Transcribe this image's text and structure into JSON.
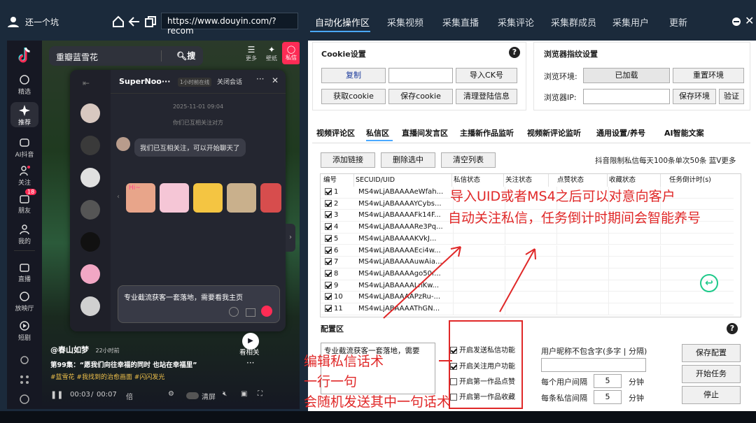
{
  "topbar": {
    "username": "还一个坑",
    "url": "https://www.douyin.com/?recom",
    "tabs": [
      "自动化操作区",
      "采集视频",
      "采集直播",
      "采集评论",
      "采集群成员",
      "采集用户",
      "更新"
    ]
  },
  "douyin": {
    "search_text": "重瓣蓝雪花",
    "search_button": "搜索",
    "top_icons": [
      "更多",
      "壁纸",
      "私信"
    ],
    "sidebar": [
      {
        "label": "精选",
        "icon": "globe-icon"
      },
      {
        "label": "推荐",
        "icon": "sparkle-icon"
      },
      {
        "label": "AI抖音",
        "icon": "ai-icon"
      },
      {
        "label": "关注",
        "icon": "follow-icon"
      },
      {
        "label": "朋友",
        "icon": "friends-icon",
        "badge": "18"
      },
      {
        "label": "我的",
        "icon": "user-icon"
      },
      {
        "label": "直播",
        "icon": "tv-icon"
      },
      {
        "label": "放映厅",
        "icon": "cinema-icon"
      },
      {
        "label": "短剧",
        "icon": "play-icon"
      }
    ],
    "chat": {
      "name": "SuperNoo···",
      "status": "1小时前在线",
      "close_label": "关闭会话",
      "date": "2025-11-01 09:04",
      "system_note": "你们已互相关注对方",
      "message": "我们已互相关注，可以开始聊天了",
      "sticker_text": "Hi~",
      "input_text": "专业截流获客一套落地，需要看我主页"
    },
    "video": {
      "author": "@春山如梦",
      "time_ago": "22小时前",
      "episode": "第99集：“愿我们向往幸福的同时 也站在幸福里”",
      "hashtags": "#蓝雪花 #我找到的治愈画面 #闪闪发光",
      "time_current": "00:03",
      "time_total": "00:07",
      "speed": "倍",
      "clear_label": "清屏",
      "side_label": "看相关"
    }
  },
  "cookie": {
    "title": "Cookie设置",
    "copy": "复制",
    "import": "导入CK号",
    "get": "获取cookie",
    "save": "保存cookie",
    "clear": "清理登陆信息"
  },
  "fingerprint": {
    "title": "浏览器指纹设置",
    "env_label": "浏览环境:",
    "env_value": "已加载",
    "reset": "重置环境",
    "ip_label": "浏览器IP:",
    "save_env": "保存环境",
    "verify": "验证"
  },
  "tabs2": [
    "视频评论区",
    "私信区",
    "直播间发言区",
    "主播新作品监听",
    "视频新评论监听",
    "通用设置/养号",
    "AI智能文案"
  ],
  "dm": {
    "add": "添加链接",
    "delete": "删除选中",
    "clear": "清空列表",
    "limit_note": "抖音限制私信每天100条单次50条 蓝V更多",
    "columns": [
      "编号",
      "SECUID/UID",
      "私信状态",
      "关注状态",
      "点赞状态",
      "收藏状态",
      "任务倒计时(s)"
    ],
    "rows": [
      {
        "num": "1",
        "uid": "MS4wLjABAAAAeWfah..."
      },
      {
        "num": "2",
        "uid": "MS4wLjABAAAAYCybs..."
      },
      {
        "num": "3",
        "uid": "MS4wLjABAAAAFk14F..."
      },
      {
        "num": "4",
        "uid": "MS4wLjABAAAARe3Pq..."
      },
      {
        "num": "5",
        "uid": "MS4wLjABAAAAKVkJ..."
      },
      {
        "num": "6",
        "uid": "MS4wLjABAAAAEci4w..."
      },
      {
        "num": "7",
        "uid": "MS4wLjABAAAAuwAia..."
      },
      {
        "num": "8",
        "uid": "MS4wLjABAAAAgo50r..."
      },
      {
        "num": "9",
        "uid": "MS4wLjABAAAALnKw..."
      },
      {
        "num": "10",
        "uid": "MS4wLjABAAAAPzRu-..."
      },
      {
        "num": "11",
        "uid": "MS4wLjABAAAAThGN..."
      }
    ]
  },
  "config": {
    "title": "配置区",
    "message_text": "专业截流获客一套落地，需要",
    "options": [
      {
        "label": "开启发送私信功能",
        "checked": true
      },
      {
        "label": "开启关注用户功能",
        "checked": true
      },
      {
        "label": "开启第一作品点赞",
        "checked": false
      },
      {
        "label": "开启第一作品收藏",
        "checked": false
      }
    ],
    "nickname_label": "用户昵称不包含字(多字 | 分隔)",
    "interval_user_label": "每个用户间隔",
    "interval_user_value": "5",
    "interval_dm_label": "每条私信间隔",
    "interval_dm_value": "5",
    "unit": "分钟",
    "save_config": "保存配置",
    "start": "开始任务",
    "stop": "停止"
  },
  "annotations": {
    "line1": "导入UID或者MS4之后可以对意向客户",
    "line2": "自动关注私信，任务倒计时期间会智能养号",
    "line3": "编辑私信话术",
    "line4": "一行一句",
    "line5": "会随机发送其中一句话术"
  },
  "colors": {
    "annotation_red": "#e02828",
    "topbar_bg": "#1b2a3b",
    "douyin_bg": "#161823",
    "accent_pink": "#fe2c55",
    "refresh_green": "#1ec98a"
  }
}
